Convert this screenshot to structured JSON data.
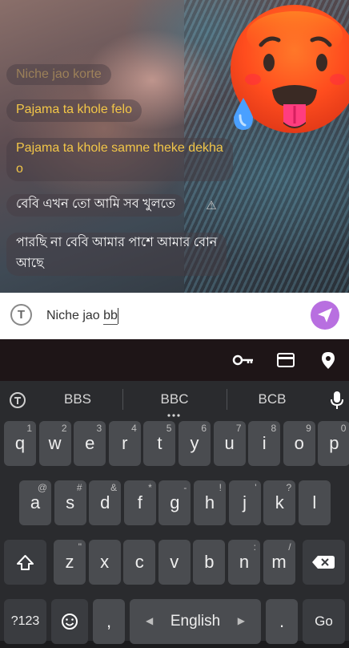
{
  "chat": {
    "messages": [
      {
        "text": "Niche jao korte",
        "style": "faded"
      },
      {
        "text": "Pajama ta khole felo",
        "style": "yellow"
      },
      {
        "text_line1": "Pajama ta khole samne theke dekha",
        "text_line2": "o",
        "style": "yellow"
      },
      {
        "text": "বেবি এখন তো আমি সব খুলতে",
        "style": "white"
      },
      {
        "text_line1": "পারছি না বেবি আমার পাশে আমার বোন",
        "text_line2": "আছে",
        "style": "white"
      }
    ]
  },
  "input": {
    "value": "Niche jao bb"
  },
  "suggestions": [
    "BBS",
    "BBC",
    "BCB"
  ],
  "keyboard": {
    "row1": [
      {
        "k": "q",
        "h": "1"
      },
      {
        "k": "w",
        "h": "2"
      },
      {
        "k": "e",
        "h": "3"
      },
      {
        "k": "r",
        "h": "4"
      },
      {
        "k": "t",
        "h": "5"
      },
      {
        "k": "y",
        "h": "6"
      },
      {
        "k": "u",
        "h": "7"
      },
      {
        "k": "i",
        "h": "8"
      },
      {
        "k": "o",
        "h": "9"
      },
      {
        "k": "p",
        "h": "0"
      }
    ],
    "row2": [
      {
        "k": "a",
        "h": "@"
      },
      {
        "k": "s",
        "h": "#"
      },
      {
        "k": "d",
        "h": "&"
      },
      {
        "k": "f",
        "h": "*"
      },
      {
        "k": "g",
        "h": "-"
      },
      {
        "k": "h",
        "h": "!"
      },
      {
        "k": "j",
        "h": "'"
      },
      {
        "k": "k",
        "h": "?"
      },
      {
        "k": "l",
        "h": ""
      }
    ],
    "row3": [
      {
        "k": "z",
        "h": "\""
      },
      {
        "k": "x",
        "h": ""
      },
      {
        "k": "c",
        "h": ""
      },
      {
        "k": "v",
        "h": ""
      },
      {
        "k": "b",
        "h": ""
      },
      {
        "k": "n",
        "h": ":"
      },
      {
        "k": "m",
        "h": "/"
      }
    ],
    "symbols_label": "?123",
    "comma": ",",
    "space_label": "English",
    "period": ".",
    "go_label": "Go"
  },
  "colors": {
    "send": "#b86fe0",
    "yellow_text": "#f2c648"
  }
}
